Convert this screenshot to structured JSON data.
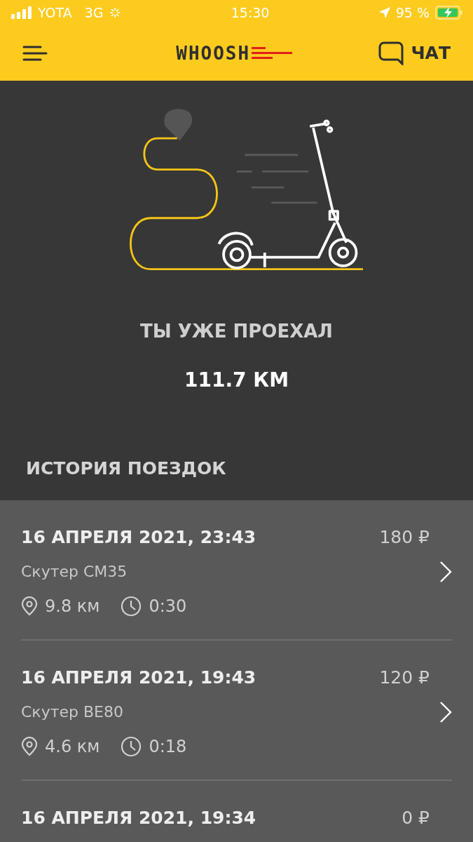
{
  "status_bar": {
    "carrier": "YOTA",
    "network": "3G",
    "time": "15:30",
    "battery": "95 %"
  },
  "header": {
    "logo": "WHOOSH",
    "chat": "ЧАТ"
  },
  "summary": {
    "label": "ТЫ УЖЕ ПРОЕХАЛ",
    "distance": "111.7 КМ"
  },
  "history": {
    "title": "ИСТОРИЯ ПОЕЗДОК",
    "trips": [
      {
        "date": "16 АПРЕЛЯ 2021, 23:43",
        "price": "180 ₽",
        "scooter": "Скутер CM35",
        "distance": "9.8 км",
        "duration": "0:30"
      },
      {
        "date": "16 АПРЕЛЯ 2021, 19:43",
        "price": "120 ₽",
        "scooter": "Скутер BE80",
        "distance": "4.6 км",
        "duration": "0:18"
      },
      {
        "date": "16 АПРЕЛЯ 2021, 19:34",
        "price": "0 ₽"
      }
    ]
  }
}
